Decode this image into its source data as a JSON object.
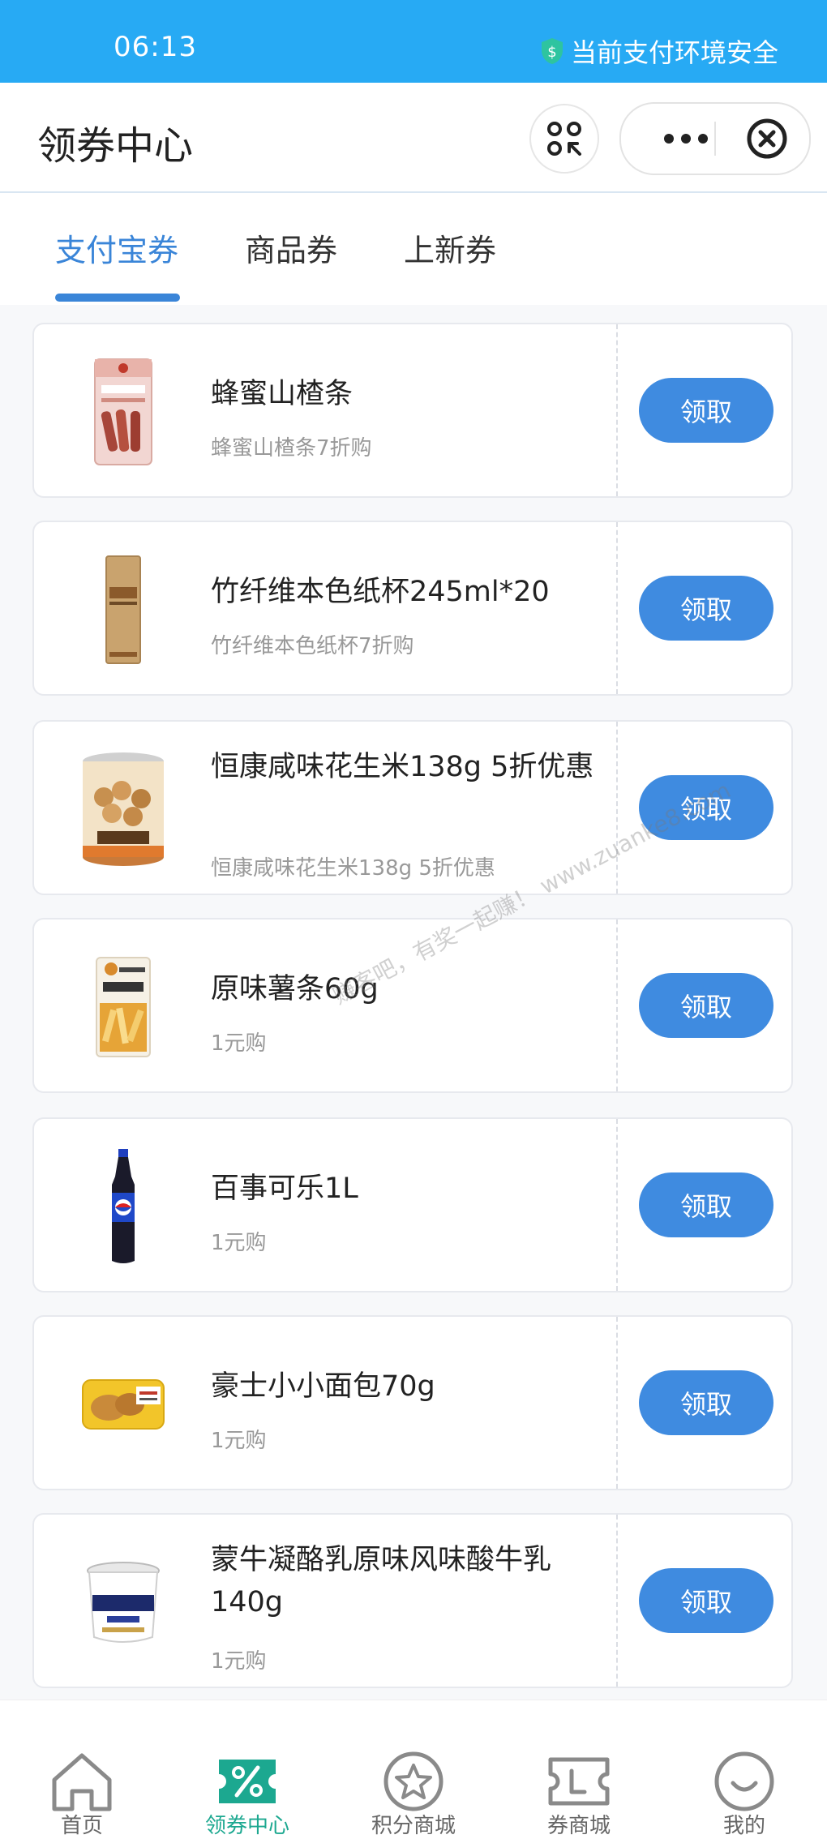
{
  "status_bar": {
    "time": "06:13",
    "safety_text": "当前支付环境安全"
  },
  "header": {
    "title": "领券中心"
  },
  "tabs": [
    {
      "label": "支付宝券",
      "active": true
    },
    {
      "label": "商品券",
      "active": false
    },
    {
      "label": "上新券",
      "active": false
    }
  ],
  "coupons": [
    {
      "name": "蜂蜜山楂条",
      "desc": "蜂蜜山楂条7折购",
      "button": "领取",
      "image_icon": "hawthorn-snack-bag"
    },
    {
      "name": "竹纤维本色纸杯245ml*20",
      "desc": "竹纤维本色纸杯7折购",
      "button": "领取",
      "image_icon": "paper-cup-pack"
    },
    {
      "name": "恒康咸味花生米138g 5折优惠",
      "desc": "恒康咸味花生米138g 5折优惠",
      "button": "领取",
      "image_icon": "peanut-can"
    },
    {
      "name": "原味薯条60g",
      "desc": "1元购",
      "button": "领取",
      "image_icon": "fries-bag"
    },
    {
      "name": "百事可乐1L",
      "desc": "1元购",
      "button": "领取",
      "image_icon": "cola-bottle"
    },
    {
      "name": "豪士小小面包70g",
      "desc": "1元购",
      "button": "领取",
      "image_icon": "bread-pack"
    },
    {
      "name": "蒙牛凝酪乳原味风味酸牛乳140g",
      "desc": "1元购",
      "button": "领取",
      "image_icon": "yogurt-cup"
    }
  ],
  "watermark": "赚客吧，有奖一起赚！ www.zuanke8.com",
  "bottom_nav": [
    {
      "label": "首页",
      "icon": "home-icon",
      "active": false
    },
    {
      "label": "领券中心",
      "icon": "coupon-percent-icon",
      "active": true
    },
    {
      "label": "积分商城",
      "icon": "star-circle-icon",
      "active": false
    },
    {
      "label": "券商城",
      "icon": "ticket-icon",
      "active": false
    },
    {
      "label": "我的",
      "icon": "profile-smile-icon",
      "active": false
    }
  ],
  "colors": {
    "status_bar": "#27aaf4",
    "accent_blue": "#3a85d8",
    "button_blue": "#3f8be0",
    "nav_active": "#1ca890",
    "shield_green": "#2ec4a0"
  }
}
